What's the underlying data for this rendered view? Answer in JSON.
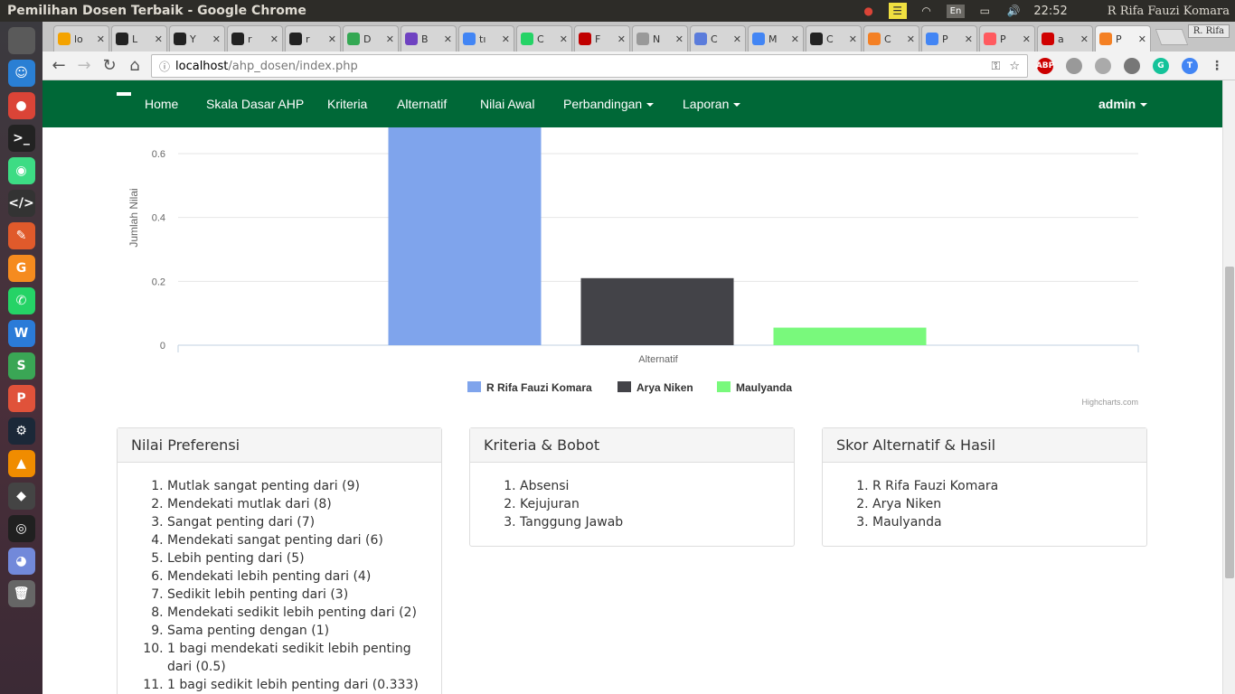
{
  "window": {
    "title": "Pemilihan Dosen Terbaik - Google Chrome"
  },
  "tray": {
    "lang": "En",
    "time": "22:52",
    "user": "R Rifa Fauzi Komara"
  },
  "launcher": [
    {
      "name": "ubuntu-dash",
      "color": "#5a5a5a",
      "glyph": ""
    },
    {
      "name": "finder",
      "color": "#2a7fd4",
      "glyph": "☺"
    },
    {
      "name": "chrome",
      "color": "#db4437",
      "glyph": "●"
    },
    {
      "name": "terminal",
      "color": "#222222",
      "glyph": ">_"
    },
    {
      "name": "android-studio",
      "color": "#3ddc84",
      "glyph": "◉"
    },
    {
      "name": "sublime",
      "color": "#333333",
      "glyph": "</>"
    },
    {
      "name": "inkscape",
      "color": "#e05a2b",
      "glyph": "✎"
    },
    {
      "name": "pdf-reader",
      "color": "#f58b1f",
      "glyph": "G"
    },
    {
      "name": "whatsapp",
      "color": "#25d366",
      "glyph": "✆"
    },
    {
      "name": "wps-writer",
      "color": "#2b7bd8",
      "glyph": "W"
    },
    {
      "name": "wps-spreadsheet",
      "color": "#3aa655",
      "glyph": "S"
    },
    {
      "name": "wps-presentation",
      "color": "#e0523a",
      "glyph": "P"
    },
    {
      "name": "steam",
      "color": "#1b2838",
      "glyph": "⚙"
    },
    {
      "name": "vlc",
      "color": "#f08c00",
      "glyph": "▲"
    },
    {
      "name": "inkscape-2",
      "color": "#444444",
      "glyph": "◆"
    },
    {
      "name": "obs",
      "color": "#202020",
      "glyph": "◎"
    },
    {
      "name": "discord",
      "color": "#7289da",
      "glyph": "◕"
    },
    {
      "name": "trash",
      "color": "#666666",
      "glyph": "🗑"
    }
  ],
  "tabs": [
    {
      "label": "lo",
      "color": "#f4a300"
    },
    {
      "label": "L",
      "color": "#222222"
    },
    {
      "label": "Y",
      "color": "#222222"
    },
    {
      "label": "r",
      "color": "#222222"
    },
    {
      "label": "r",
      "color": "#222222"
    },
    {
      "label": "D",
      "color": "#34a853"
    },
    {
      "label": "B",
      "color": "#6f42c1"
    },
    {
      "label": "tı",
      "color": "#4285f4"
    },
    {
      "label": "C",
      "color": "#25d366"
    },
    {
      "label": "F",
      "color": "#c00000"
    },
    {
      "label": "N",
      "color": "#999999"
    },
    {
      "label": "C",
      "color": "#5b7cdb"
    },
    {
      "label": "M",
      "color": "#4285f4"
    },
    {
      "label": "C",
      "color": "#222222"
    },
    {
      "label": "C",
      "color": "#f48024"
    },
    {
      "label": "P",
      "color": "#4285f4"
    },
    {
      "label": "P",
      "color": "#ff5a5f"
    },
    {
      "label": "a",
      "color": "#d00000"
    },
    {
      "label": "P",
      "color": "#f48024"
    }
  ],
  "browser": {
    "profile": "R. Rifa",
    "url_host": "localhost",
    "url_path": "/ahp_dosen/index.php"
  },
  "navbar": {
    "items": [
      {
        "label": "Home",
        "dropdown": false
      },
      {
        "label": "Skala Dasar AHP",
        "dropdown": false
      },
      {
        "label": "Kriteria",
        "dropdown": false
      },
      {
        "label": "Alternatif",
        "dropdown": false
      },
      {
        "label": "Nilai Awal",
        "dropdown": false
      },
      {
        "label": "Perbandingan",
        "dropdown": true
      },
      {
        "label": "Laporan",
        "dropdown": true
      }
    ],
    "user": "admin"
  },
  "chart_data": {
    "type": "bar",
    "categories": [
      "Alternatif"
    ],
    "series": [
      {
        "name": "R Rifa Fauzi Komara",
        "values": [
          0.73
        ],
        "color": "#7fa4ec"
      },
      {
        "name": "Arya Niken",
        "values": [
          0.21
        ],
        "color": "#434348"
      },
      {
        "name": "Maulyanda",
        "values": [
          0.055
        ],
        "color": "#79f97c"
      }
    ],
    "ylabel": "Jumlah Nilai",
    "xlabel": "Alternatif",
    "yticks": [
      "0",
      "0.2",
      "0.4",
      "0.6"
    ],
    "ylim": [
      0,
      0.68
    ],
    "grid": true,
    "legend": "bottom-center",
    "credits": "Highcharts.com"
  },
  "panels": [
    {
      "title": "Nilai Preferensi",
      "items": [
        "Mutlak sangat penting dari (9)",
        "Mendekati mutlak dari (8)",
        "Sangat penting dari (7)",
        "Mendekati sangat penting dari (6)",
        "Lebih penting dari (5)",
        "Mendekati lebih penting dari (4)",
        "Sedikit lebih penting dari (3)",
        "Mendekati sedikit lebih penting dari (2)",
        "Sama penting dengan (1)",
        "1 bagi mendekati sedikit lebih penting dari (0.5)",
        "1 bagi sedikit lebih penting dari (0.333)"
      ]
    },
    {
      "title": "Kriteria & Bobot",
      "items": [
        "Absensi",
        "Kejujuran",
        "Tanggung Jawab"
      ]
    },
    {
      "title": "Skor Alternatif & Hasil",
      "items": [
        "R Rifa Fauzi Komara",
        "Arya Niken",
        "Maulyanda"
      ]
    }
  ]
}
